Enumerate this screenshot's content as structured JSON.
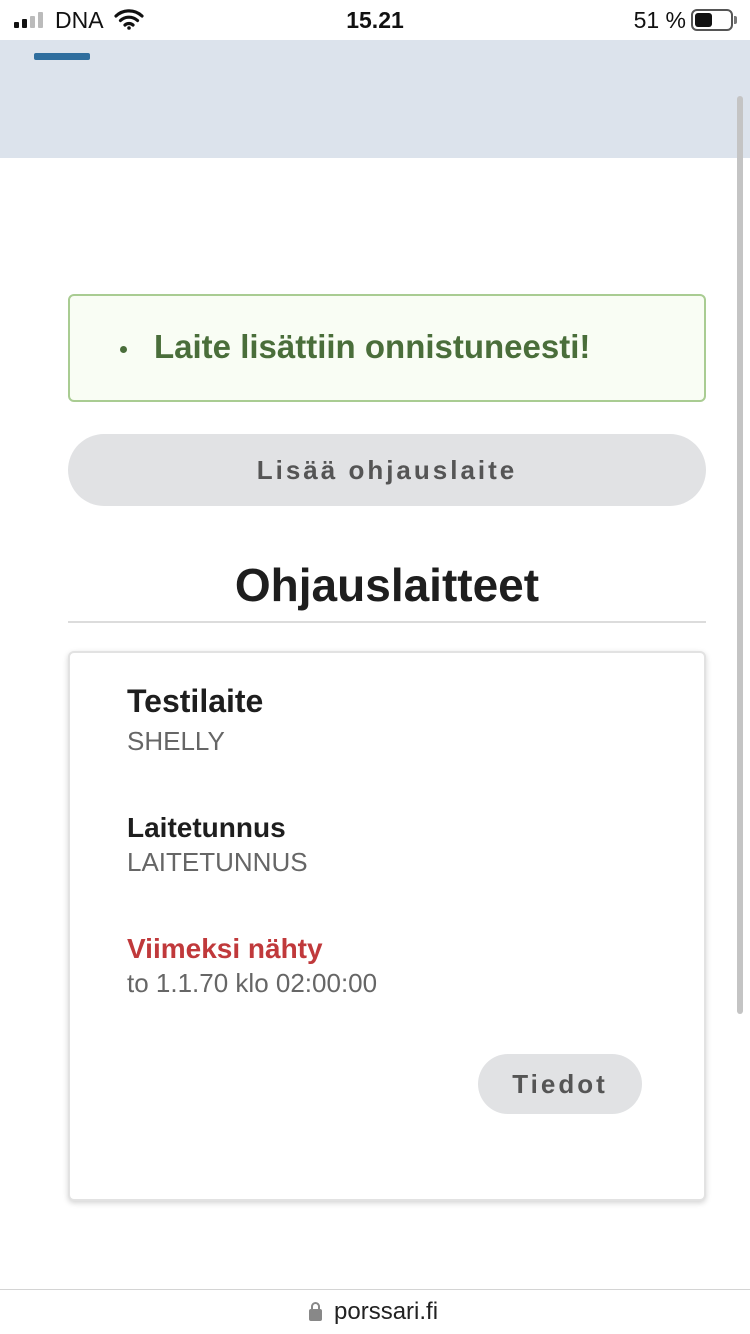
{
  "status_bar": {
    "carrier": "DNA",
    "time": "15.21",
    "battery_percent": "51 %",
    "battery_level": 0.51,
    "signal_bars_active": 2,
    "signal_bars_total": 4
  },
  "alert": {
    "message": "Laite lisättiin onnistuneesti!"
  },
  "actions": {
    "add_device_label": "Lisää ohjauslaite"
  },
  "section": {
    "title": "Ohjauslaitteet"
  },
  "device": {
    "name": "Testilaite",
    "type": "SHELLY",
    "id_label": "Laitetunnus",
    "id_value": "LAITETUNNUS",
    "last_seen_label": "Viimeksi nähty",
    "last_seen_value": "to 1.1.70 klo 02:00:00",
    "details_label": "Tiedot"
  },
  "browser": {
    "url": "porssari.fi"
  },
  "colors": {
    "header_bg": "#dce3ec",
    "menu_accent": "#2f6e9e",
    "success_text": "#4a6e3a",
    "success_border": "#a9cc92",
    "warning_text": "#c0393b",
    "button_bg": "#e1e2e4"
  }
}
